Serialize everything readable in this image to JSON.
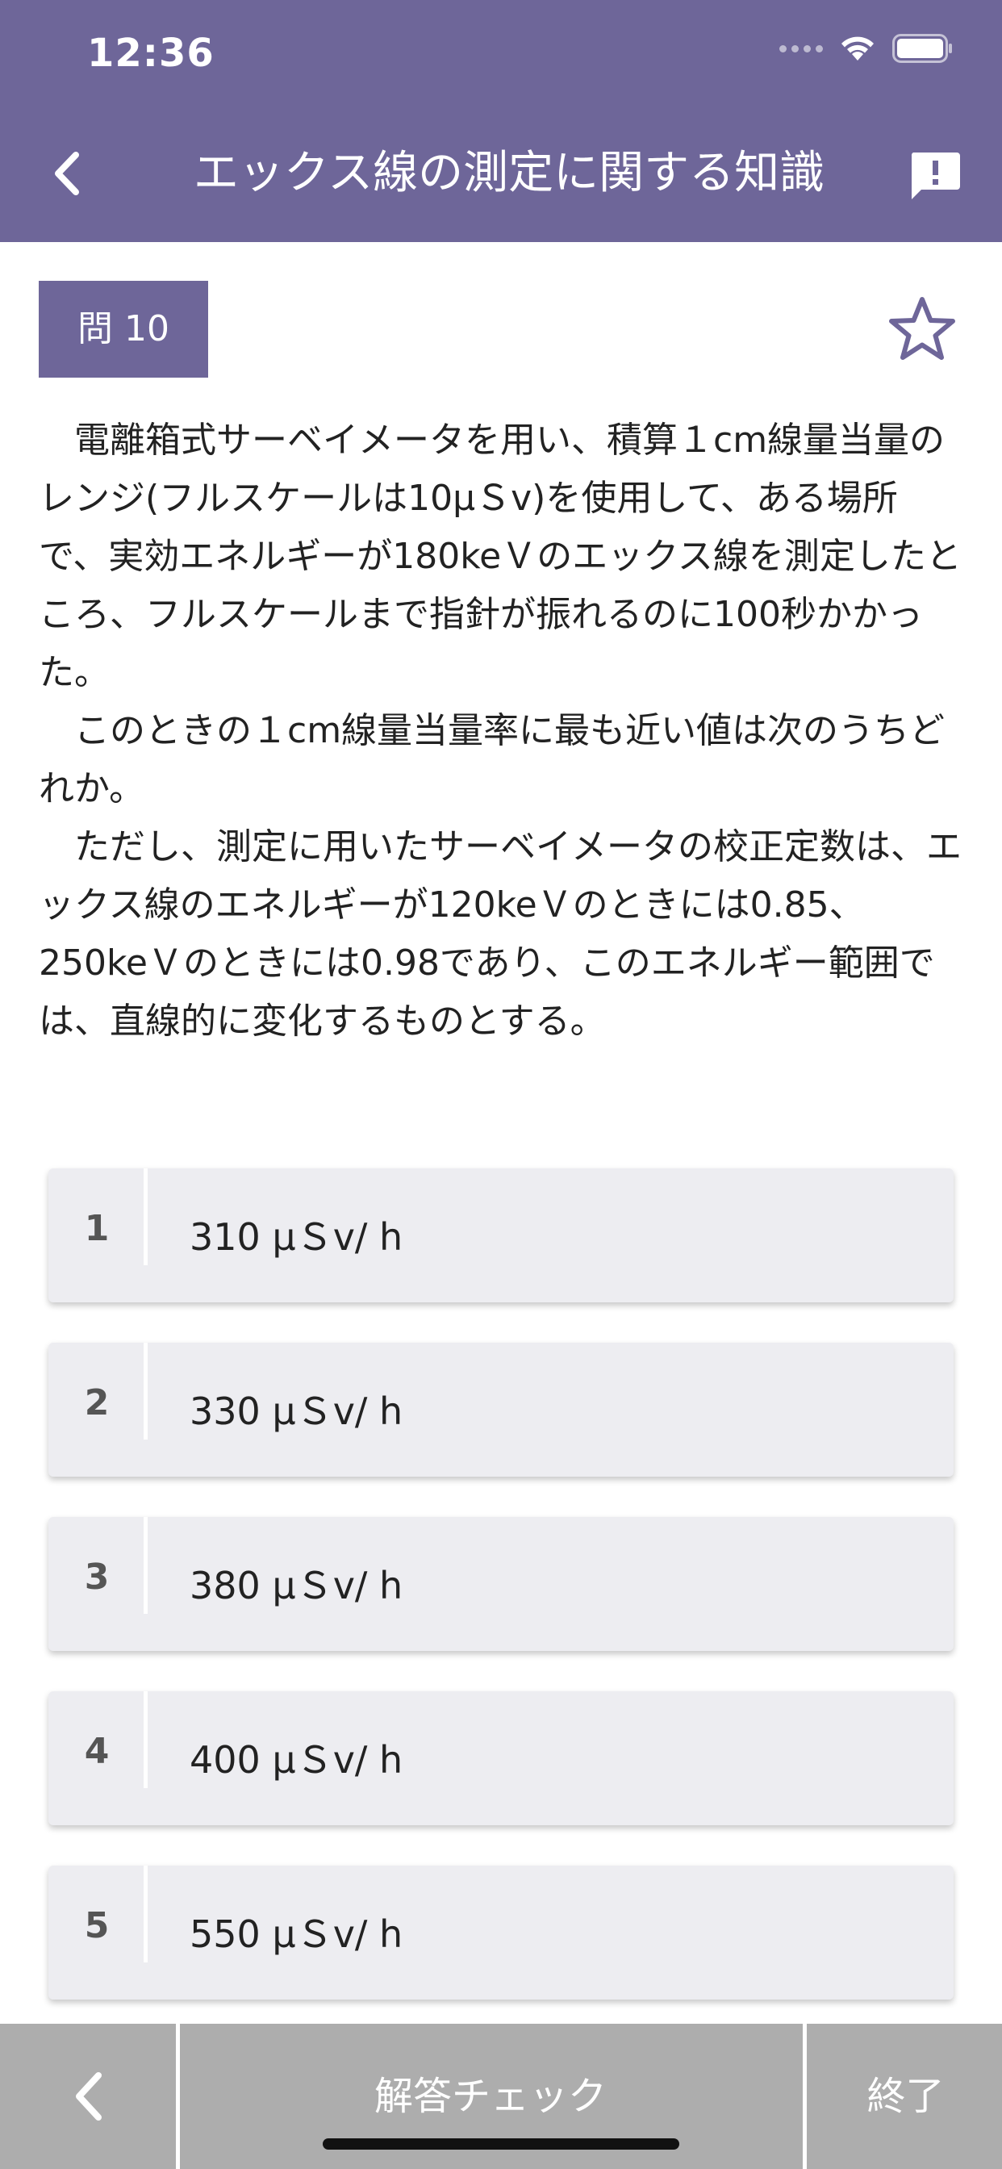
{
  "status_bar": {
    "time": "12:36"
  },
  "header": {
    "title": "エックス線の測定に関する知識",
    "back_icon": "chevron-left-icon",
    "report_icon": "report-icon"
  },
  "question": {
    "badge": "問 10",
    "favorite_icon": "star-outline-icon",
    "paragraphs": [
      "電離箱式サーベイメータを用い、積算１cm線量当量のレンジ(フルスケールは10μＳv)を使用して、ある場所で、実効エネルギーが180keＶのエックス線を測定したところ、フルスケールまで指針が振れるのに100秒かかった。",
      "このときの１cm線量当量率に最も近い値は次のうちどれか。",
      "ただし、測定に用いたサーベイメータの校正定数は、エックス線のエネルギーが120keＶのときには0.85、250keＶのときには0.98であり、このエネルギー範囲では、直線的に変化するものとする。"
    ]
  },
  "choices": [
    {
      "number": "1",
      "text": "310 μＳv/ h"
    },
    {
      "number": "2",
      "text": "330 μＳv/ h"
    },
    {
      "number": "3",
      "text": "380 μＳv/ h"
    },
    {
      "number": "4",
      "text": "400 μＳv/ h"
    },
    {
      "number": "5",
      "text": "550 μＳv/ h"
    }
  ],
  "toolbar": {
    "back_icon": "chevron-left-icon",
    "check_label": "解答チェック",
    "end_label": "終了"
  },
  "colors": {
    "accent": "#6e6699",
    "choice_bg": "#ededf1",
    "toolbar_bg": "#adadad"
  }
}
